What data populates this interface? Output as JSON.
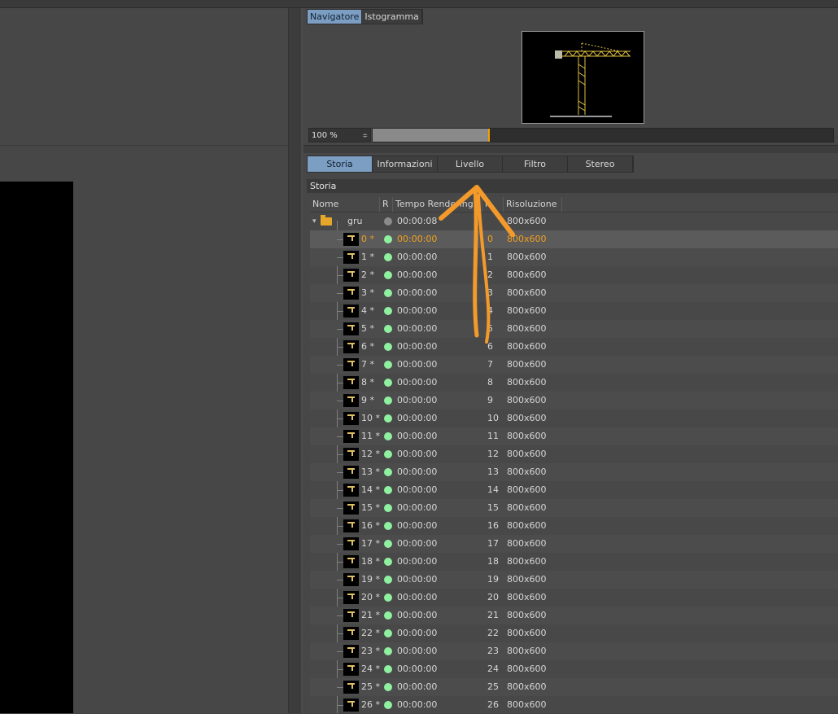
{
  "colors": {
    "accent_tab": "#7c9ec3",
    "selected_text": "#f0a020",
    "status_green": "#8ff0a0",
    "annotation_arrow": "#f39a2b"
  },
  "navigator": {
    "tabs": [
      {
        "label": "Navigatore",
        "active": true
      },
      {
        "label": "Istogramma",
        "active": false
      }
    ],
    "zoom": {
      "value": "100 %",
      "arrows": "≑",
      "fill_fraction": 0.25
    }
  },
  "history": {
    "tabs": [
      {
        "label": "Storia",
        "active": true
      },
      {
        "label": "Informazioni",
        "active": false
      },
      {
        "label": "Livello",
        "active": false
      },
      {
        "label": "Filtro",
        "active": false
      },
      {
        "label": "Stereo",
        "active": false
      }
    ],
    "section_title": "Storia",
    "columns": {
      "name": "Nome",
      "r": "R",
      "time": "Tempo Rendering",
      "f": "F",
      "res": "Risoluzione"
    },
    "group": {
      "name": "gru",
      "time": "00:00:08",
      "res": "800x600"
    },
    "rows": [
      {
        "name": "0 *",
        "time": "00:00:00",
        "f": "0",
        "res": "800x600",
        "selected": true
      },
      {
        "name": "1 *",
        "time": "00:00:00",
        "f": "1",
        "res": "800x600"
      },
      {
        "name": "2 *",
        "time": "00:00:00",
        "f": "2",
        "res": "800x600"
      },
      {
        "name": "3 *",
        "time": "00:00:00",
        "f": "3",
        "res": "800x600"
      },
      {
        "name": "4 *",
        "time": "00:00:00",
        "f": "4",
        "res": "800x600"
      },
      {
        "name": "5 *",
        "time": "00:00:00",
        "f": "5",
        "res": "800x600"
      },
      {
        "name": "6 *",
        "time": "00:00:00",
        "f": "6",
        "res": "800x600"
      },
      {
        "name": "7 *",
        "time": "00:00:00",
        "f": "7",
        "res": "800x600"
      },
      {
        "name": "8 *",
        "time": "00:00:00",
        "f": "8",
        "res": "800x600"
      },
      {
        "name": "9 *",
        "time": "00:00:00",
        "f": "9",
        "res": "800x600"
      },
      {
        "name": "10 *",
        "time": "00:00:00",
        "f": "10",
        "res": "800x600"
      },
      {
        "name": "11 *",
        "time": "00:00:00",
        "f": "11",
        "res": "800x600"
      },
      {
        "name": "12 *",
        "time": "00:00:00",
        "f": "12",
        "res": "800x600"
      },
      {
        "name": "13 *",
        "time": "00:00:00",
        "f": "13",
        "res": "800x600"
      },
      {
        "name": "14 *",
        "time": "00:00:00",
        "f": "14",
        "res": "800x600"
      },
      {
        "name": "15 *",
        "time": "00:00:00",
        "f": "15",
        "res": "800x600"
      },
      {
        "name": "16 *",
        "time": "00:00:00",
        "f": "16",
        "res": "800x600"
      },
      {
        "name": "17 *",
        "time": "00:00:00",
        "f": "17",
        "res": "800x600"
      },
      {
        "name": "18 *",
        "time": "00:00:00",
        "f": "18",
        "res": "800x600"
      },
      {
        "name": "19 *",
        "time": "00:00:00",
        "f": "19",
        "res": "800x600"
      },
      {
        "name": "20 *",
        "time": "00:00:00",
        "f": "20",
        "res": "800x600"
      },
      {
        "name": "21 *",
        "time": "00:00:00",
        "f": "21",
        "res": "800x600"
      },
      {
        "name": "22 *",
        "time": "00:00:00",
        "f": "22",
        "res": "800x600"
      },
      {
        "name": "23 *",
        "time": "00:00:00",
        "f": "23",
        "res": "800x600"
      },
      {
        "name": "24 *",
        "time": "00:00:00",
        "f": "24",
        "res": "800x600"
      },
      {
        "name": "25 *",
        "time": "00:00:00",
        "f": "25",
        "res": "800x600"
      },
      {
        "name": "26 *",
        "time": "00:00:00",
        "f": "26",
        "res": "800x600"
      }
    ]
  }
}
